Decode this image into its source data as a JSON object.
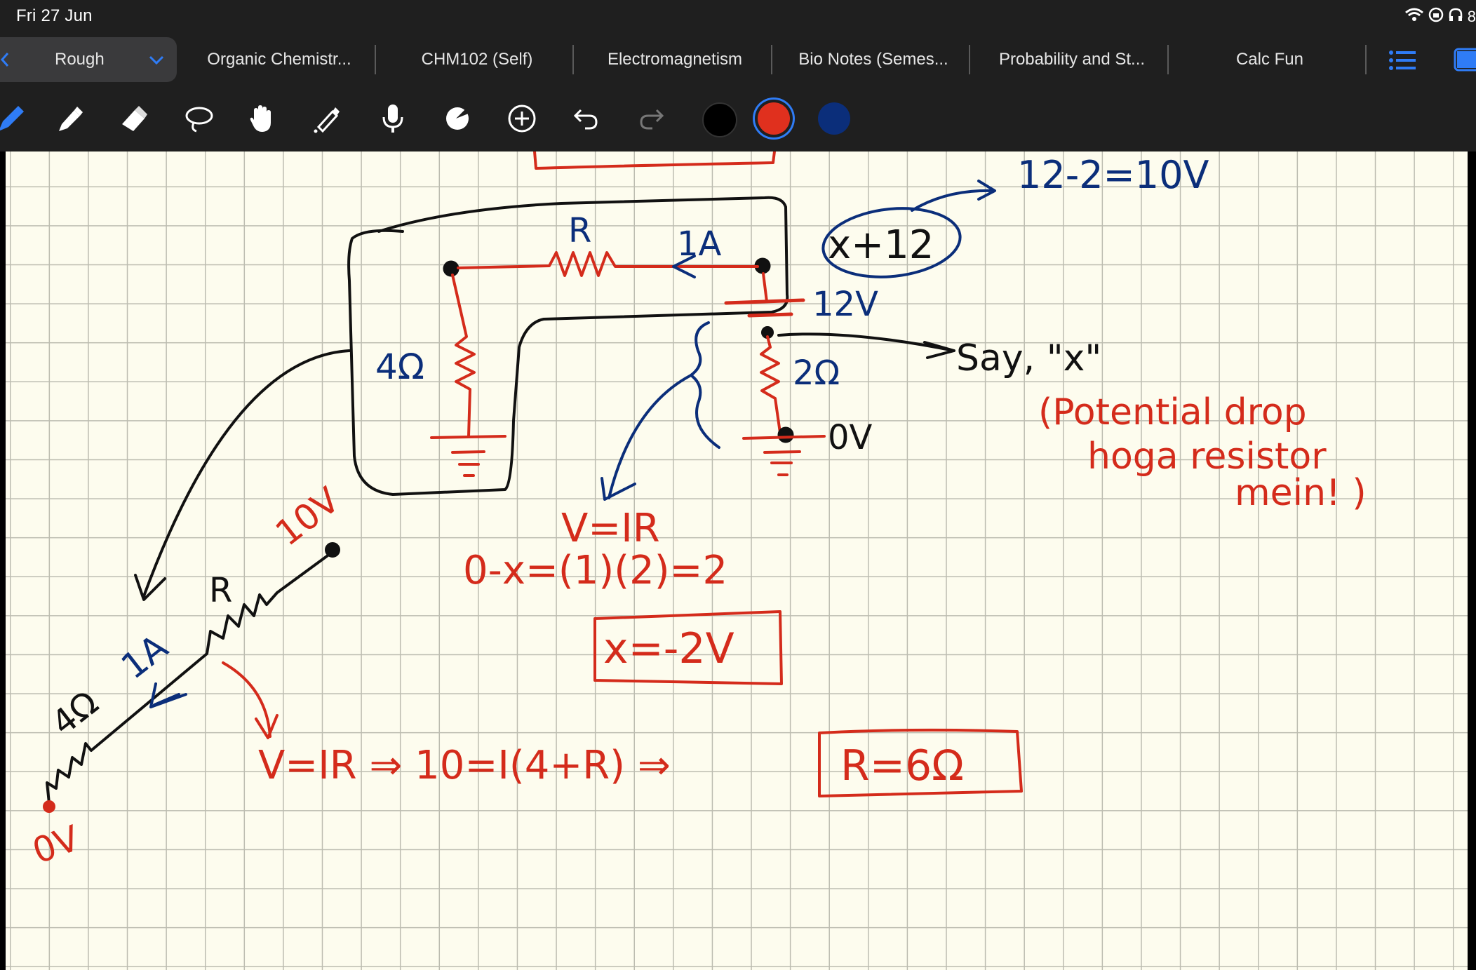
{
  "status_bar": {
    "date": "Fri 27 Jun",
    "right_partial": "8"
  },
  "tabs": [
    {
      "label": "Rough",
      "active": true
    },
    {
      "label": "Organic Chemistr..."
    },
    {
      "label": "CHM102 (Self)"
    },
    {
      "label": "Electromagnetism"
    },
    {
      "label": "Bio Notes (Semes..."
    },
    {
      "label": "Probability and St..."
    },
    {
      "label": "Calc Fun"
    }
  ],
  "toolbar": {
    "tools": [
      "pen-icon",
      "highlighter-icon",
      "eraser-icon",
      "lasso-icon",
      "hand-icon",
      "laser-pointer-icon",
      "microphone-icon",
      "shape-icon",
      "add-icon",
      "undo-icon",
      "redo-icon"
    ],
    "colors": [
      "#000000",
      "#e0301e",
      "#0b2e7a"
    ],
    "selected_color": "#e0301e"
  },
  "notes": {
    "top_right_calc": "12-2=10V",
    "node_label": "x+12",
    "battery": "12V",
    "current_top": "1A",
    "resistor_top": "R",
    "resistor_left": "4Ω",
    "resistor_right": "2Ω",
    "ground_label": "0V",
    "say_x": "Say, \"x\"",
    "potential_line1": "(Potential drop",
    "potential_line2": "hoga resistor",
    "potential_line3": "mein! )",
    "v_ir_1": "V=IR",
    "eq_1": "0-x=(1)(2)=2",
    "result_x": "x=-2V",
    "wire_10v": "10V",
    "wire_r": "R",
    "wire_current": "1A",
    "wire_4ohm": "4Ω",
    "wire_0v": "0V",
    "eq_2": "V=IR ⇒ 10=I(4+R) ⇒",
    "result_r": "R=6Ω"
  }
}
